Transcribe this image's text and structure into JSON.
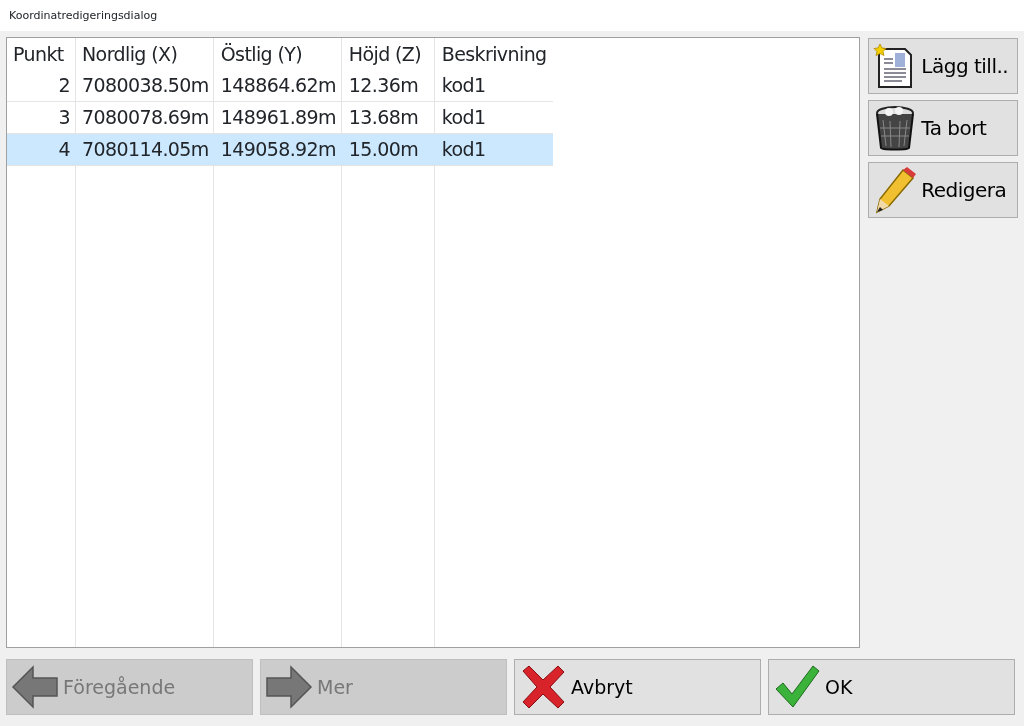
{
  "window": {
    "title": "Koordinatredigeringsdialog"
  },
  "table": {
    "columns": [
      "Punkt",
      "Nordlig (X)",
      "Östlig (Y)",
      "Höjd (Z)",
      "Beskrivning"
    ],
    "rows": [
      {
        "cells": [
          "2",
          "7080038.50m",
          "148864.62m",
          "12.36m",
          "kod1"
        ],
        "selected": false
      },
      {
        "cells": [
          "3",
          "7080078.69m",
          "148961.89m",
          "13.68m",
          "kod1"
        ],
        "selected": false
      },
      {
        "cells": [
          "4",
          "7080114.05m",
          "149058.92m",
          "15.00m",
          "kod1"
        ],
        "selected": true
      }
    ]
  },
  "side_buttons": [
    {
      "label": "Lägg till..",
      "kind": "add"
    },
    {
      "label": "Ta bort",
      "kind": "delete"
    },
    {
      "label": "Redigera",
      "kind": "edit"
    }
  ],
  "bottom_buttons": [
    {
      "label": "Föregående",
      "kind": "back",
      "disabled": true
    },
    {
      "label": "Mer",
      "kind": "next",
      "disabled": true
    },
    {
      "label": "Avbryt",
      "kind": "cancel",
      "disabled": false
    },
    {
      "label": "OK",
      "kind": "ok",
      "disabled": false
    }
  ]
}
